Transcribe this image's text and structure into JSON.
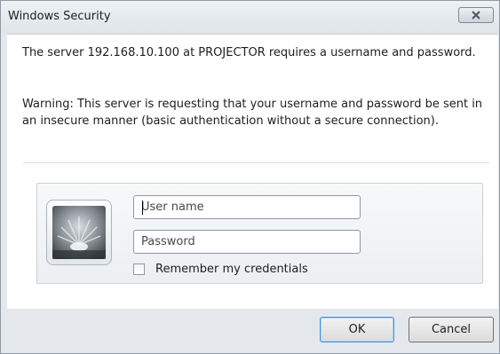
{
  "window": {
    "title": "Windows Security",
    "close_icon": "close-icon"
  },
  "message": {
    "line1": "The server 192.168.10.100 at PROJECTOR requires a username and password.",
    "warning": "Warning: This server is requesting that your username and password be sent in an insecure manner (basic authentication without a secure connection)."
  },
  "credentials": {
    "avatar_icon": "user-tile-icon",
    "username_placeholder": "User name",
    "username_value": "",
    "password_placeholder": "Password",
    "password_value": "",
    "remember_label": "Remember my credentials",
    "remember_checked": false
  },
  "buttons": {
    "ok_label": "OK",
    "cancel_label": "Cancel"
  },
  "colors": {
    "window_frame": "#e4e8ec",
    "client_background": "#ffffff",
    "default_button_border": "#4f8fd6"
  }
}
